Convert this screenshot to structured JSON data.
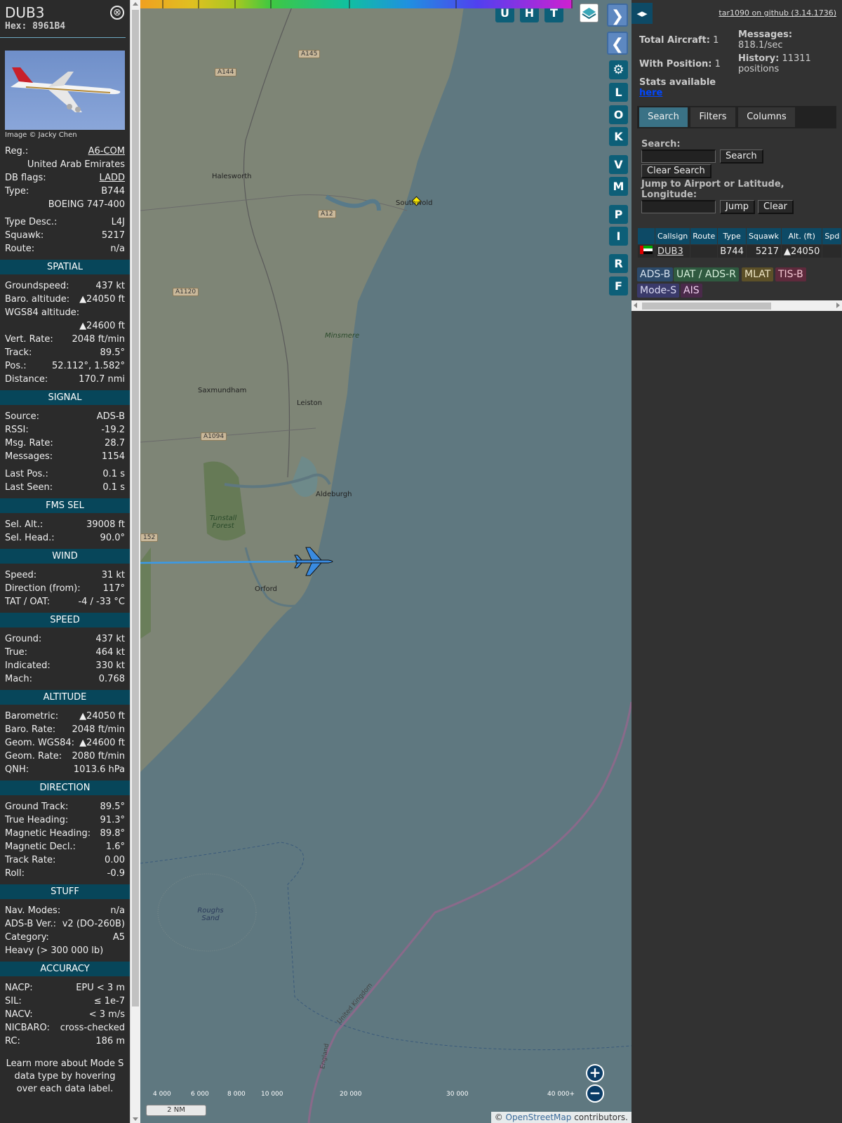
{
  "sidebar": {
    "callsign": "DUB3",
    "hex_label": "Hex:",
    "hex": "8961B4",
    "close_glyph": "⊗",
    "photo_caption": "Image © Jacky Chen",
    "rows_top": [
      {
        "label": "Reg.:",
        "value": "A6-COM",
        "link": true
      },
      {
        "label": "",
        "value": "United Arab Emirates"
      },
      {
        "label": "DB flags:",
        "value": "LADD",
        "link": true
      },
      {
        "label": "Type:",
        "value": "B744"
      },
      {
        "label": "",
        "value": "BOEING 747-400"
      }
    ],
    "rows_top2": [
      {
        "label": "Type Desc.:",
        "value": "L4J"
      },
      {
        "label": "Squawk:",
        "value": "5217"
      },
      {
        "label": "Route:",
        "value": "n/a"
      }
    ],
    "spatial_title": "SPATIAL",
    "spatial": [
      {
        "label": "Groundspeed:",
        "value": "437 kt"
      },
      {
        "label": "Baro. altitude:",
        "value": "▲24050 ft"
      },
      {
        "label": "WGS84 altitude:",
        "value": ""
      },
      {
        "label": "",
        "value": "▲24600 ft"
      },
      {
        "label": "Vert. Rate:",
        "value": "2048 ft/min"
      },
      {
        "label": "Track:",
        "value": "89.5°"
      },
      {
        "label": "Pos.:",
        "value": "52.112°, 1.582°"
      },
      {
        "label": "Distance:",
        "value": "170.7 nmi"
      }
    ],
    "signal_title": "SIGNAL",
    "signal": [
      {
        "label": "Source:",
        "value": "ADS-B"
      },
      {
        "label": "RSSI:",
        "value": "-19.2"
      },
      {
        "label": "Msg. Rate:",
        "value": "28.7"
      },
      {
        "label": "Messages:",
        "value": "1154"
      }
    ],
    "signal2": [
      {
        "label": "Last Pos.:",
        "value": "0.1 s"
      },
      {
        "label": "Last Seen:",
        "value": "0.1 s"
      }
    ],
    "fms_title": "FMS SEL",
    "fms": [
      {
        "label": "Sel. Alt.:",
        "value": "39008 ft"
      },
      {
        "label": "Sel. Head.:",
        "value": "90.0°"
      }
    ],
    "wind_title": "WIND",
    "wind": [
      {
        "label": "Speed:",
        "value": "31 kt"
      },
      {
        "label": "Direction (from):",
        "value": "117°"
      },
      {
        "label": "TAT / OAT:",
        "value": "-4 / -33 °C"
      }
    ],
    "speed_title": "SPEED",
    "speed": [
      {
        "label": "Ground:",
        "value": "437 kt"
      },
      {
        "label": "True:",
        "value": "464 kt"
      },
      {
        "label": "Indicated:",
        "value": "330 kt"
      },
      {
        "label": "Mach:",
        "value": "0.768"
      }
    ],
    "altitude_title": "ALTITUDE",
    "altitude": [
      {
        "label": "Barometric:",
        "value": "▲24050 ft"
      },
      {
        "label": "Baro. Rate:",
        "value": "2048 ft/min"
      },
      {
        "label": "Geom. WGS84:",
        "value": "▲24600 ft"
      },
      {
        "label": "Geom. Rate:",
        "value": "2080 ft/min"
      },
      {
        "label": "QNH:",
        "value": "1013.6 hPa"
      }
    ],
    "direction_title": "DIRECTION",
    "direction": [
      {
        "label": "Ground Track:",
        "value": "89.5°"
      },
      {
        "label": "True Heading:",
        "value": "91.3°"
      },
      {
        "label": "Magnetic Heading:",
        "value": "89.8°"
      },
      {
        "label": "Magnetic Decl.:",
        "value": "1.6°"
      },
      {
        "label": "Track Rate:",
        "value": "0.00"
      },
      {
        "label": "Roll:",
        "value": "-0.9"
      }
    ],
    "stuff_title": "STUFF",
    "stuff": [
      {
        "label": "Nav. Modes:",
        "value": "n/a"
      },
      {
        "label": "ADS-B Ver.:",
        "value": "v2 (DO-260B)"
      },
      {
        "label": "Category:",
        "value": "A5"
      },
      {
        "label": "Heavy (> 300 000 lb)",
        "value": ""
      }
    ],
    "accuracy_title": "ACCURACY",
    "accuracy": [
      {
        "label": "NACP:",
        "value": "EPU < 3 m"
      },
      {
        "label": "SIL:",
        "value": "≤ 1e-7"
      },
      {
        "label": "NACV:",
        "value": "< 3 m/s"
      },
      {
        "label": "NICBARO:",
        "value": "cross-checked"
      },
      {
        "label": "RC:",
        "value": "186 m"
      }
    ],
    "footer": "Learn more about Mode S data type by hovering over each data label."
  },
  "map": {
    "top_buttons": [
      "U",
      "H",
      "T"
    ],
    "side_buttons": [
      "L",
      "O",
      "K",
      "V",
      "M",
      "P",
      "I",
      "R",
      "F"
    ],
    "next_glyph": "❯",
    "prev_glyph": "❮",
    "settings_glyph": "⚙",
    "towns": [
      "Halesworth",
      "Southwold",
      "Saxmundham",
      "Leiston",
      "Aldeburgh",
      "Orford",
      "Minsmere",
      "Tunstall Forest",
      "Roughs Sand",
      "United Kingdom",
      "England"
    ],
    "roads": [
      "A145",
      "A144",
      "A12",
      "A1120",
      "A1094",
      "152"
    ],
    "scale_labels": [
      "4 000",
      "6 000",
      "8 000",
      "10 000",
      "20 000",
      "30 000",
      "40 000+"
    ],
    "scale_bar": "2 NM",
    "zoom_in": "+",
    "zoom_out": "−",
    "attribution_prefix": "©",
    "attribution_link": "OpenStreetMap",
    "attribution_suffix": "contributors."
  },
  "panel": {
    "toggle_glyph": "◂▸",
    "github": "tar1090 on github (3.14.1736)",
    "total_aircraft_label": "Total Aircraft:",
    "total_aircraft": "1",
    "with_position_label": "With Position:",
    "with_position": "1",
    "stats_label": "Stats available",
    "stats_link": "here",
    "messages_label": "Messages:",
    "messages_rate": "818.1/sec",
    "history_label": "History:",
    "history_value": "11311",
    "history_unit": "positions",
    "tabs": [
      "Search",
      "Filters",
      "Columns"
    ],
    "search_label": "Search:",
    "search_button": "Search",
    "clear_search_button": "Clear Search",
    "jump_label": "Jump to Airport or Latitude, Longitude:",
    "jump_button": "Jump",
    "clear_button": "Clear",
    "table_headers": [
      "",
      "Callsign",
      "Route",
      "Type",
      "Squawk",
      "Alt. (ft)",
      "Spd"
    ],
    "table_rows": [
      {
        "callsign": "DUB3",
        "route": "",
        "type": "B744",
        "squawk": "5217",
        "alt": "▲24050",
        "spd": ""
      }
    ],
    "legend": [
      {
        "label": "ADS-B",
        "color": "#2c4a6a",
        "text": "#d8e4f0"
      },
      {
        "label": "UAT / ADS-R",
        "color": "#2f5a40",
        "text": "#d8f0dc"
      },
      {
        "label": "MLAT",
        "color": "#5c5028",
        "text": "#f0e8c8"
      },
      {
        "label": "TIS-B",
        "color": "#5e2a3c",
        "text": "#f5c8d4"
      },
      {
        "label": "Mode-S",
        "color": "#3a3a6a",
        "text": "#dcdcf5"
      },
      {
        "label": "AIS",
        "color": "#4a2a4a",
        "text": "#f0d0f0"
      }
    ]
  }
}
